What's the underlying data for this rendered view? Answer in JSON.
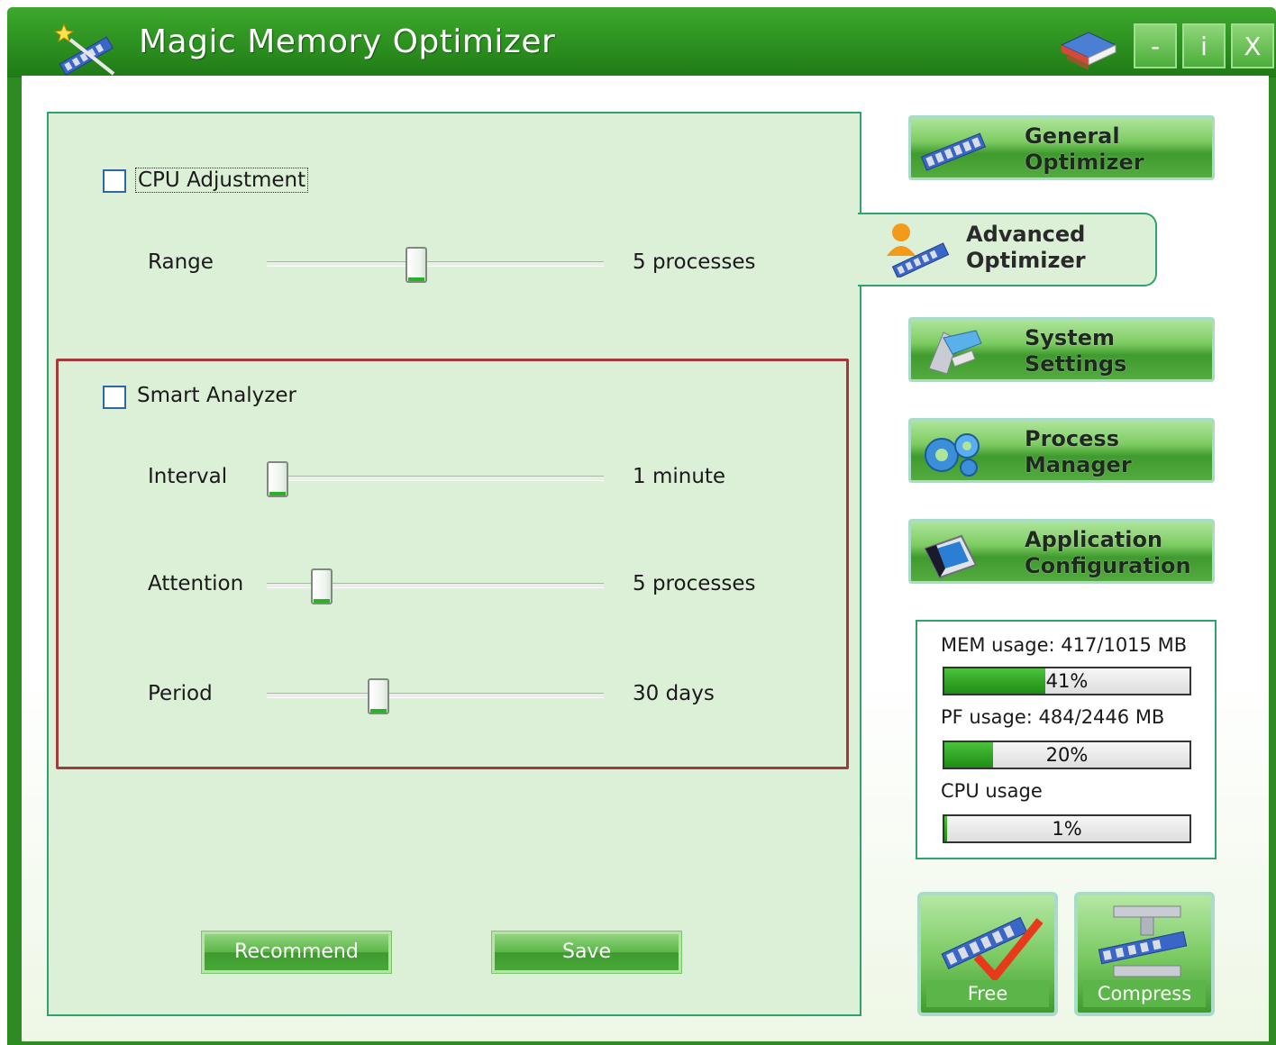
{
  "window": {
    "title": "Magic Memory Optimizer",
    "minimize_label": "-",
    "maximize_label": "i",
    "close_label": "X"
  },
  "cpu": {
    "checkbox_label": "CPU Adjustment",
    "checked": false,
    "range_label": "Range",
    "range_value": "5 processes",
    "range_level": 0.44
  },
  "smart": {
    "checkbox_label": "Smart Analyzer",
    "checked": false,
    "interval_label": "Interval",
    "interval_value": "1 minute",
    "interval_level": 0.0,
    "attention_label": "Attention",
    "attention_value": "5 processes",
    "attention_level": 0.14,
    "period_label": "Period",
    "period_value": "30 days",
    "period_level": 0.32
  },
  "buttons": {
    "recommend": "Recommend",
    "save": "Save"
  },
  "nav": {
    "general": [
      "General",
      "Optimizer"
    ],
    "advanced": [
      "Advanced",
      "Optimizer"
    ],
    "system": [
      "System",
      "Settings"
    ],
    "process": [
      "Process",
      "Manager"
    ],
    "application": [
      "Application",
      "Configuration"
    ]
  },
  "usage": {
    "mem_label": "MEM usage: 417/1015 MB",
    "mem_percent": "41%",
    "mem_level": 0.41,
    "pf_label": "PF usage: 484/2446 MB",
    "pf_percent": "20%",
    "pf_level": 0.2,
    "cpu_label": "CPU usage",
    "cpu_percent": "1%",
    "cpu_level": 0.01
  },
  "actions": {
    "free": "Free",
    "compress": "Compress"
  }
}
